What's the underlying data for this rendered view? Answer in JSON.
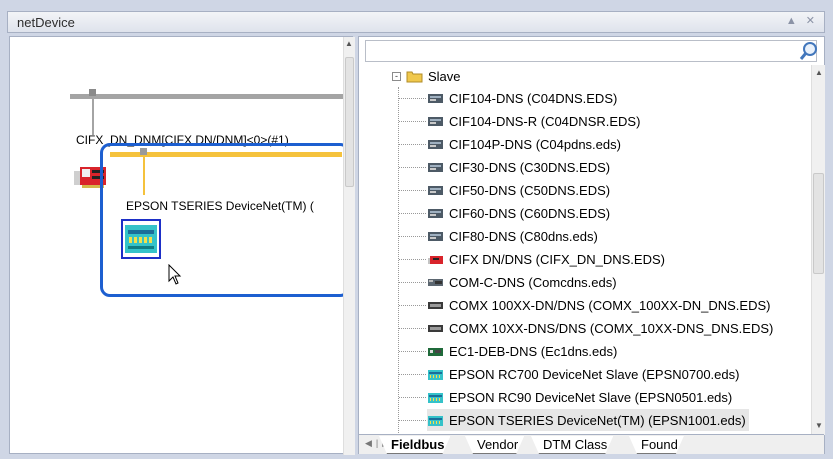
{
  "window": {
    "title": "netDevice",
    "controls": "▲ ✕"
  },
  "network_view": {
    "master_label": "CIFX_DN_DNM[CIFX DN/DNM]<0>(#1)",
    "slave_label": "EPSON TSERIES DeviceNet(TM) (",
    "colors": {
      "master_bus": "#a4a4a4",
      "slave_bus": "#f5c23c",
      "selection_border": "#1d5fd0"
    }
  },
  "catalog": {
    "search": {
      "value": "",
      "placeholder": ""
    },
    "folder_label": "Slave",
    "items": [
      {
        "label": "CIF104-DNS (C04DNS.EDS)",
        "icon": "module-card-icon"
      },
      {
        "label": "CIF104-DNS-R (C04DNSR.EDS)",
        "icon": "module-card-icon"
      },
      {
        "label": "CIF104P-DNS (C04pdns.eds)",
        "icon": "module-card-icon"
      },
      {
        "label": "CIF30-DNS (C30DNS.EDS)",
        "icon": "module-card-icon"
      },
      {
        "label": "CIF50-DNS (C50DNS.EDS)",
        "icon": "module-card-icon"
      },
      {
        "label": "CIF60-DNS (C60DNS.EDS)",
        "icon": "module-card-icon"
      },
      {
        "label": "CIF80-DNS (C80dns.eds)",
        "icon": "module-card-icon"
      },
      {
        "label": "CIFX DN/DNS (CIFX_DN_DNS.EDS)",
        "icon": "cifx-card-icon"
      },
      {
        "label": "COM-C-DNS (Comcdns.eds)",
        "icon": "com-module-icon"
      },
      {
        "label": "COMX 100XX-DN/DNS (COMX_100XX-DN_DNS.EDS)",
        "icon": "comx-module-icon"
      },
      {
        "label": "COMX 10XX-DNS/DNS (COMX_10XX-DNS_DNS.EDS)",
        "icon": "comx-module-icon"
      },
      {
        "label": "EC1-DEB-DNS (Ec1dns.eds)",
        "icon": "ec1-module-icon"
      },
      {
        "label": "EPSON RC700 DeviceNet Slave (EPSN0700.eds)",
        "icon": "epson-device-icon"
      },
      {
        "label": "EPSON RC90 DeviceNet Slave (EPSN0501.eds)",
        "icon": "epson-device-icon"
      },
      {
        "label": "EPSON TSERIES DeviceNet(TM) (EPSN1001.eds)",
        "icon": "epson-device-icon",
        "selected": true
      }
    ],
    "tabs": [
      {
        "label": "Fieldbus",
        "active": true
      },
      {
        "label": "Vendor",
        "active": false
      },
      {
        "label": "DTM Class",
        "active": false
      },
      {
        "label": "Found",
        "active": false
      }
    ]
  }
}
